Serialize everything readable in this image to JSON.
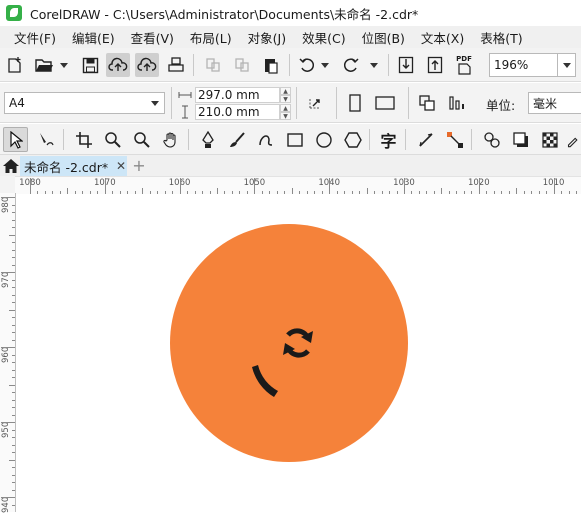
{
  "window": {
    "title": "CorelDRAW - C:\\Users\\Administrator\\Documents\\未命名 -2.cdr*"
  },
  "menu": [
    "文件(F)",
    "编辑(E)",
    "查看(V)",
    "布局(L)",
    "对象(J)",
    "效果(C)",
    "位图(B)",
    "文本(X)",
    "表格(T)"
  ],
  "toolbar": {
    "zoom_value": "196%",
    "pdf_label": "PDF"
  },
  "property_bar": {
    "page_size": "A4",
    "width": "297.0 mm",
    "height": "210.0 mm",
    "units_label": "单位:",
    "units_value": "毫米"
  },
  "toolbox": {
    "text_tool_glyph": "字"
  },
  "tabs": {
    "document": "未命名 -2.cdr*",
    "close": "✕",
    "add": "+"
  },
  "ruler": {
    "h_labels": [
      "1080",
      "1070",
      "1060",
      "1050",
      "1040",
      "1030",
      "1020",
      "1010"
    ],
    "v_labels": [
      "980",
      "970",
      "960",
      "950",
      "940"
    ]
  },
  "canvas": {
    "circle_color": "#f5823a",
    "icon_color": "#1a1a1a",
    "icons": [
      "refresh-icon",
      "arc-shape"
    ]
  },
  "colors": {
    "accent": "#cde6f7",
    "menu_bg": "#f0f0f0",
    "toolbar_bg": "#f3f3f3"
  }
}
